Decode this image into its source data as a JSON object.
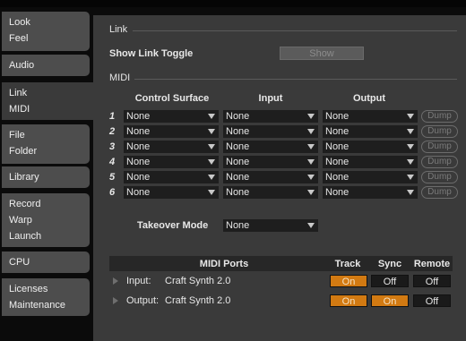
{
  "sidebar": [
    {
      "lines": [
        "Look",
        "Feel"
      ]
    },
    {
      "lines": [
        "Audio"
      ]
    },
    {
      "lines": [
        "Link",
        "MIDI"
      ]
    },
    {
      "lines": [
        "File",
        "Folder"
      ]
    },
    {
      "lines": [
        "Library"
      ]
    },
    {
      "lines": [
        "Record",
        "Warp",
        "Launch"
      ]
    },
    {
      "lines": [
        "CPU"
      ]
    },
    {
      "lines": [
        "Licenses",
        "Maintenance"
      ]
    }
  ],
  "link": {
    "section_title": "Link",
    "toggle_label": "Show Link Toggle",
    "toggle_button": "Show"
  },
  "midi": {
    "section_title": "MIDI",
    "headers": {
      "control_surface": "Control Surface",
      "input": "Input",
      "output": "Output"
    },
    "rows": [
      {
        "num": "1",
        "surface": "None",
        "input": "None",
        "output": "None",
        "dump": "Dump"
      },
      {
        "num": "2",
        "surface": "None",
        "input": "None",
        "output": "None",
        "dump": "Dump"
      },
      {
        "num": "3",
        "surface": "None",
        "input": "None",
        "output": "None",
        "dump": "Dump"
      },
      {
        "num": "4",
        "surface": "None",
        "input": "None",
        "output": "None",
        "dump": "Dump"
      },
      {
        "num": "5",
        "surface": "None",
        "input": "None",
        "output": "None",
        "dump": "Dump"
      },
      {
        "num": "6",
        "surface": "None",
        "input": "None",
        "output": "None",
        "dump": "Dump"
      }
    ],
    "takeover_label": "Takeover Mode",
    "takeover_value": "None"
  },
  "ports": {
    "header": {
      "title": "MIDI Ports",
      "track": "Track",
      "sync": "Sync",
      "remote": "Remote"
    },
    "rows": [
      {
        "dir": "Input:",
        "name": "Craft Synth 2.0",
        "track": "On",
        "sync": "Off",
        "remote": "Off"
      },
      {
        "dir": "Output:",
        "name": "Craft Synth 2.0",
        "track": "On",
        "sync": "On",
        "remote": "Off"
      }
    ]
  },
  "colors": {
    "accent_on": "#d27a12",
    "panel": "#3a3a3a",
    "field": "#1e1e1e"
  }
}
